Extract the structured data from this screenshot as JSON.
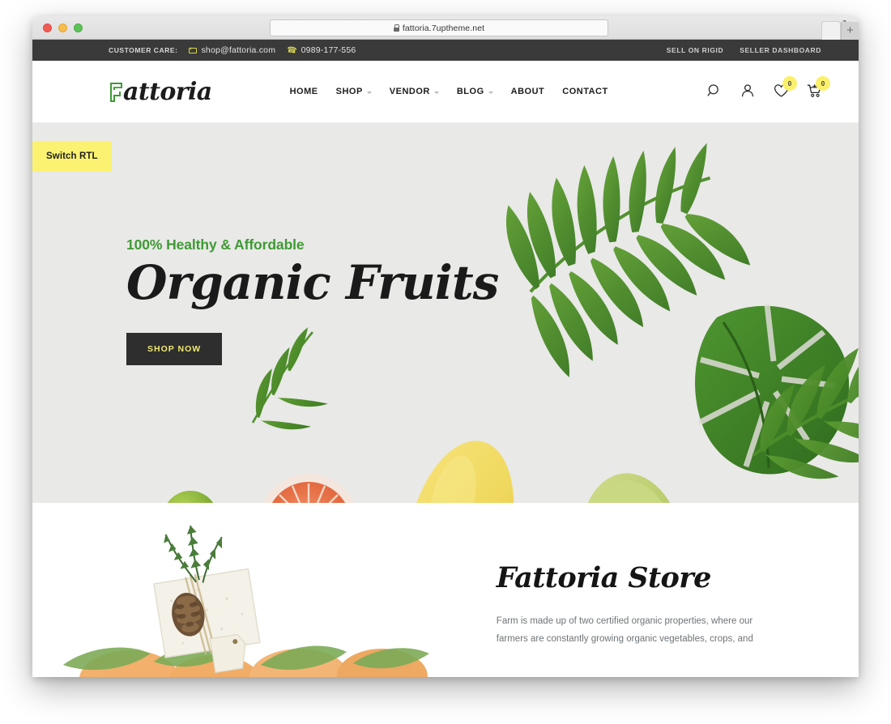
{
  "browser": {
    "url": "fattoria.7uptheme.net",
    "lock_icon": "lock-icon",
    "reload_icon": "reload-icon",
    "newtab_icon": "plus-icon",
    "traffic_lights": [
      "close",
      "minimize",
      "maximize"
    ]
  },
  "topbar": {
    "care_label": "CUSTOMER CARE:",
    "email": "shop@fattoria.com",
    "email_icon": "envelope-icon",
    "phone": "0989-177-556",
    "phone_icon": "phone-icon",
    "links": [
      {
        "label": "SELL ON RIGID"
      },
      {
        "label": "SELLER DASHBOARD"
      }
    ],
    "bg_color": "#3a3a3a",
    "accent_color": "#d8d44f"
  },
  "header": {
    "logo_text": "attoria",
    "logo_mark": "leaf-f-icon",
    "logo_accent": "#3f9a35",
    "nav": [
      {
        "label": "HOME",
        "has_dropdown": false
      },
      {
        "label": "SHOP",
        "has_dropdown": true
      },
      {
        "label": "VENDOR",
        "has_dropdown": true
      },
      {
        "label": "BLOG",
        "has_dropdown": true
      },
      {
        "label": "ABOUT",
        "has_dropdown": false
      },
      {
        "label": "CONTACT",
        "has_dropdown": false
      }
    ],
    "icons": {
      "search": "search-icon",
      "account": "user-icon",
      "wishlist": "heart-icon",
      "wishlist_count": "0",
      "cart": "cart-icon",
      "cart_count": "0",
      "badge_color": "#fbf06b"
    }
  },
  "hero": {
    "switch_rtl_label": "Switch RTL",
    "switch_rtl_color": "#fbf272",
    "subtitle": "100% Healthy & Affordable",
    "subtitle_color": "#3f9a35",
    "title": "Organic Fruits",
    "cta_label": "SHOP NOW",
    "cta_bg": "#2e2e2e",
    "cta_color": "#f0e972",
    "bg_color": "#e8e8e6"
  },
  "store": {
    "title": "Fattoria Store",
    "paragraph": "Farm is made up of two certified organic properties, where our farmers are constantly growing organic vegetables, crops, and"
  }
}
